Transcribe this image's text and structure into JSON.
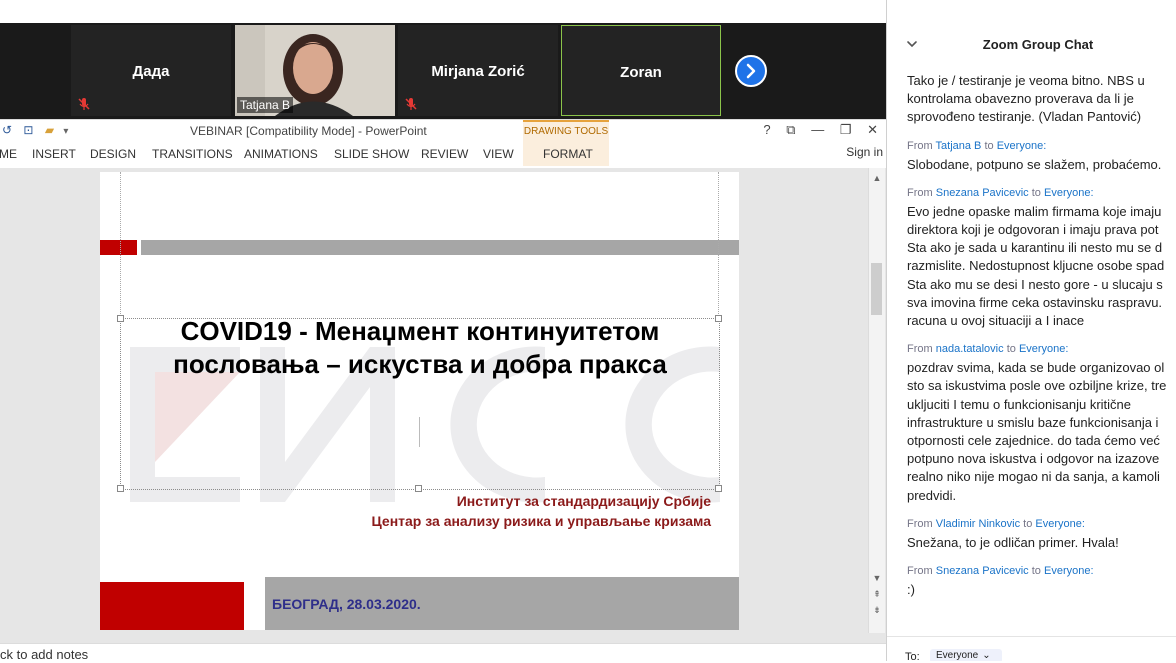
{
  "video_strip": {
    "participants": [
      {
        "name": "Дада",
        "muted": true
      },
      {
        "name": "Tatjana B",
        "muted": true
      },
      {
        "name": "Mirjana Zorić",
        "muted": true
      },
      {
        "name": "Zoran",
        "muted": false,
        "active_speaker": true
      }
    ],
    "next_icon": "chevron-right-icon"
  },
  "powerpoint": {
    "title": "VEBINAR [Compatibility Mode] - PowerPoint",
    "contextual_group": "DRAWING TOOLS",
    "tabs": [
      "ME",
      "INSERT",
      "DESIGN",
      "TRANSITIONS",
      "ANIMATIONS",
      "SLIDE SHOW",
      "REVIEW",
      "VIEW",
      "FORMAT"
    ],
    "window_controls": [
      "?",
      "⧉",
      "—",
      "❐",
      "✕"
    ],
    "sign_in": "Sign in",
    "notes_placeholder": "ck to add notes",
    "slide": {
      "title_line1": "COVID19 - Менаџмент континуитетом",
      "title_line2": "пословања – искуства и добра пракса",
      "institution_line1": "Институт за стандардизацију Србије",
      "institution_line2": "Центар за анализу ризика и управљање кризама",
      "date": "БЕОГРАД, 28.03.2020.",
      "watermark": "ИСС",
      "colors": {
        "accent_red": "#c00000",
        "band_gray": "#a6a6a6",
        "title": "#000000",
        "institution": "#8b1a1a",
        "date": "#2e2e8a"
      }
    }
  },
  "chat": {
    "title": "Zoom Group Chat",
    "collapse_icon": "chevron-down-icon",
    "messages": [
      {
        "from": "",
        "to": "",
        "lines": [
          "Tako je / testiranje je veoma bitno. NBS u",
          "kontrolama obavezno proverava da li je",
          "sprovođeno testiranje. (Vladan Pantović)"
        ]
      },
      {
        "from": "Tatjana B",
        "to": "Everyone:",
        "lines": [
          "Slobodane, potpuno se slažem, probaćemo."
        ]
      },
      {
        "from": "Snezana Pavicevic",
        "to": "Everyone:",
        "lines": [
          "Evo jedne opaske malim firmama koje imaju",
          "direktora koji je odgovoran i imaju prava pot",
          "Sta ako je sada u karantinu ili nesto mu se d",
          "razmislite. Nedostupnost kljucne osobe spad",
          "Sta ako mu se desi I nesto gore - u slucaju s",
          "sva imovina firme ceka ostavinsku raspravu.",
          "racuna u ovoj situaciji a I inace"
        ]
      },
      {
        "from": "nada.tatalovic",
        "to": "Everyone:",
        "lines": [
          "pozdrav svima, kada se bude organizovao ol",
          "sto sa iskustvima posle ove ozbiljne krize, tre",
          "ukljuciti I temu o funkcionisanju kritične",
          "infrastrukture u smislu baze funkcionisanja i",
          "otpornosti cele zajednice. do tada ćemo već",
          "potpuno nova iskustva i odgovor na izazove",
          "realno niko nije mogao ni da sanja, a kamoli",
          "predvidi."
        ]
      },
      {
        "from": "Vladimir Ninkovic",
        "to": "Everyone:",
        "lines": [
          "Snežana, to je odličan primer. Hvala!"
        ]
      },
      {
        "from": "Snezana Pavicevic",
        "to": "Everyone:",
        "lines": [
          ":)"
        ]
      }
    ],
    "from_word": "From",
    "to_word": "to",
    "recipient_label": "To:",
    "recipient_value": "Everyone",
    "accent": "#1a73c8"
  }
}
